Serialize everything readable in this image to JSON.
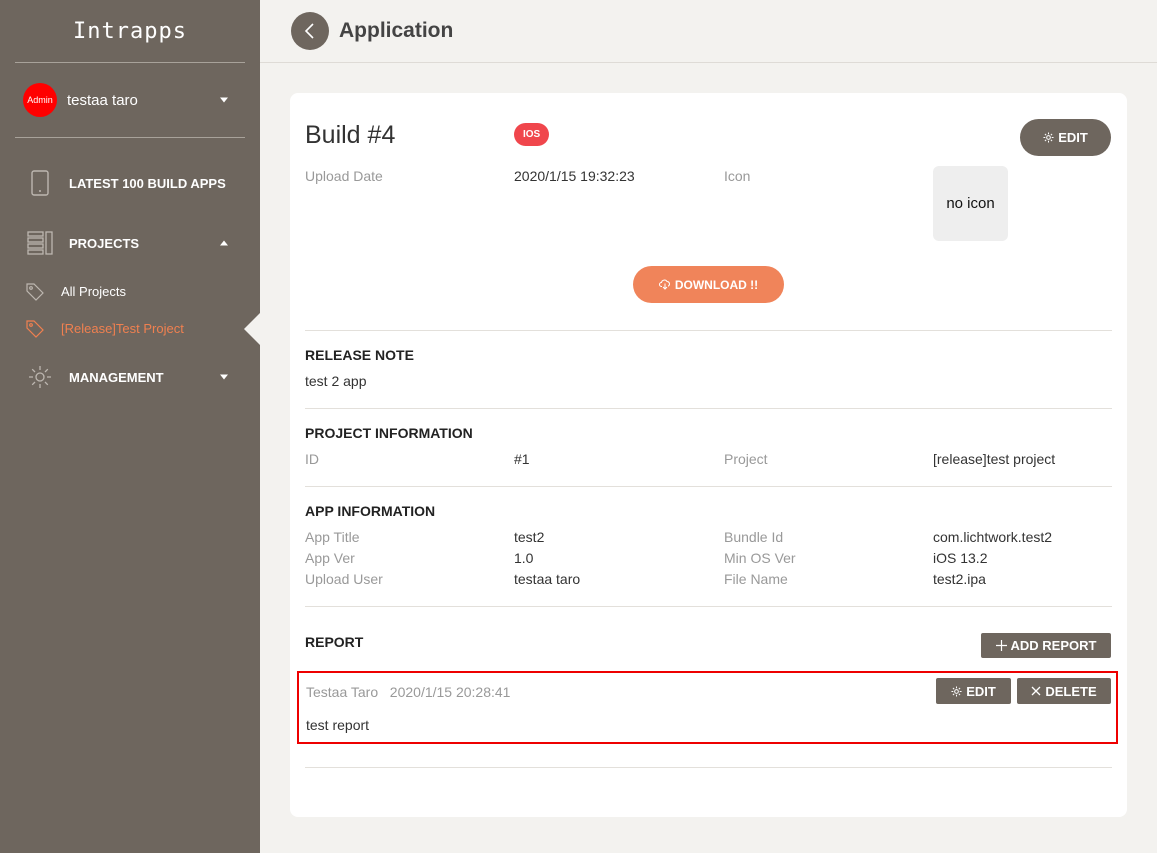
{
  "sidebar": {
    "brand": "Intrapps",
    "user": {
      "avatar_label": "Admin",
      "name": "testaa taro"
    },
    "nav": {
      "latest": "LATEST 100 BUILD APPS",
      "projects": "PROJECTS",
      "all_projects": "All Projects",
      "test_project": "[Release]Test Project",
      "management": "MANAGEMENT"
    }
  },
  "header": {
    "title": "Application"
  },
  "build": {
    "title": "Build #4",
    "platform_badge": "IOS",
    "edit_label": "EDIT",
    "upload_date_label": "Upload Date",
    "upload_date_value": "2020/1/15 19:32:23",
    "icon_label": "Icon",
    "icon_placeholder": "no icon",
    "download_label": "DOWNLOAD !!"
  },
  "release_note": {
    "title": "RELEASE NOTE",
    "text": "test 2 app"
  },
  "project_info": {
    "title": "PROJECT INFORMATION",
    "id_label": "ID",
    "id_value": "#1",
    "project_label": "Project",
    "project_value": "[release]test project"
  },
  "app_info": {
    "title": "APP INFORMATION",
    "app_title_label": "App Title",
    "app_title_value": "test2",
    "bundle_label": "Bundle Id",
    "bundle_value": "com.lichtwork.test2",
    "app_ver_label": "App Ver",
    "app_ver_value": "1.0",
    "min_os_label": "Min OS Ver",
    "min_os_value": "iOS 13.2",
    "upload_user_label": "Upload User",
    "upload_user_value": "testaa taro",
    "file_name_label": "File Name",
    "file_name_value": "test2.ipa"
  },
  "report": {
    "title": "REPORT",
    "add_label": "ADD REPORT",
    "items": [
      {
        "author": "Testaa Taro",
        "date": "2020/1/15 20:28:41",
        "text": "test report",
        "edit_label": "EDIT",
        "delete_label": "DELETE"
      }
    ]
  },
  "colors": {
    "sidebar": "#6e665e",
    "accent": "#f0845a",
    "badge": "#f0464c",
    "highlight": "#e00000"
  }
}
